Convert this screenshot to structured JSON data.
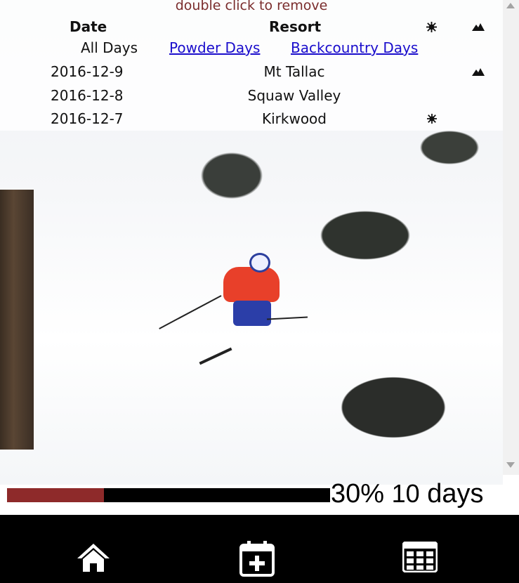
{
  "hint": "double click to remove",
  "table": {
    "headers": {
      "date": "Date",
      "resort": "Resort"
    },
    "filters": {
      "all": "All Days",
      "powder": "Powder Days",
      "backcountry": "Backcountry Days"
    },
    "rows": [
      {
        "date": "2016-12-9",
        "resort": "Mt Tallac",
        "icon": "mountain-icon"
      },
      {
        "date": "2016-12-8",
        "resort": "Squaw Valley",
        "icon": ""
      },
      {
        "date": "2016-12-7",
        "resort": "Kirkwood",
        "icon": "snowflake-icon"
      }
    ]
  },
  "progress": {
    "fraction": 0.3,
    "percent_label": "30%",
    "count": "10",
    "unit": "days",
    "fill_color": "#8e2a2a"
  },
  "nav": {
    "items": [
      "home-icon",
      "calendar-add-icon",
      "grid-icon"
    ]
  }
}
